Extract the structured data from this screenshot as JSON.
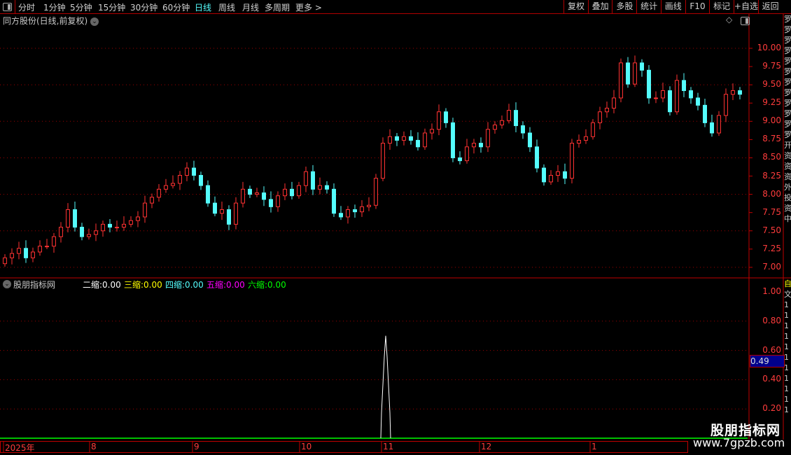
{
  "toolbar": {
    "periods": [
      "分时",
      "1分钟",
      "5分钟",
      "15分钟",
      "30分钟",
      "60分钟",
      "日线",
      "周线",
      "月线",
      "多周期",
      "更多 >"
    ],
    "active_period": "日线",
    "buttons": [
      "复权",
      "叠加",
      "多股",
      "统计",
      "画线",
      "F10",
      "标记",
      "+自选",
      "返回"
    ]
  },
  "main_chart": {
    "title": "同方股份(日线,前复权)",
    "price_ticks": [
      "10.00",
      "9.75",
      "9.50",
      "9.25",
      "9.00",
      "8.75",
      "8.50",
      "8.25",
      "8.00",
      "7.75",
      "7.50",
      "7.25",
      "7.00"
    ],
    "colors": {
      "up": "#ff3232",
      "down": "#54fcfc",
      "grid": "#a00000"
    }
  },
  "indicator": {
    "name": "股朋指标网",
    "values": [
      {
        "label": "二缩:",
        "value": "0.00",
        "color": "#ffffff"
      },
      {
        "label": "三缩:",
        "value": "0.00",
        "color": "#ffff00"
      },
      {
        "label": "四缩:",
        "value": "0.00",
        "color": "#54fcfc"
      },
      {
        "label": "五缩:",
        "value": "0.00",
        "color": "#ff00ff"
      },
      {
        "label": "六缩:",
        "value": "0.00",
        "color": "#00ff00"
      }
    ],
    "ticks": [
      "1.00",
      "0.80",
      "0.60",
      "0.40",
      "0.20"
    ],
    "cursor_value": "0.49",
    "spike_peak": 0.7
  },
  "date_axis": [
    "2025年",
    "8",
    "9",
    "10",
    "11",
    "12",
    "1"
  ],
  "watermark": {
    "name": "股朋指标网",
    "url": "www.7gpzb.com"
  },
  "chart_data": {
    "type": "candlestick",
    "ylim": [
      7.0,
      10.0
    ],
    "close": [
      7.13,
      7.19,
      7.26,
      7.13,
      7.21,
      7.29,
      7.29,
      7.42,
      7.55,
      7.79,
      7.55,
      7.42,
      7.45,
      7.5,
      7.59,
      7.55,
      7.55,
      7.59,
      7.64,
      7.69,
      7.88,
      7.96,
      8.07,
      8.12,
      8.15,
      8.26,
      8.36,
      8.26,
      8.12,
      7.88,
      7.74,
      7.79,
      7.59,
      7.88,
      8.07,
      8.0,
      8.02,
      7.93,
      7.83,
      7.98,
      8.07,
      7.98,
      8.12,
      8.31,
      8.07,
      8.12,
      8.07,
      7.74,
      7.69,
      7.79,
      7.76,
      7.83,
      7.85,
      8.22,
      8.7,
      8.79,
      8.74,
      8.79,
      8.74,
      8.65,
      8.84,
      8.89,
      9.13,
      8.98,
      8.5,
      8.46,
      8.65,
      8.7,
      8.65,
      8.89,
      8.95,
      9.01,
      9.15,
      8.94,
      8.84,
      8.65,
      8.36,
      8.17,
      8.26,
      8.31,
      8.22,
      8.7,
      8.74,
      8.79,
      8.98,
      9.13,
      9.18,
      9.32,
      9.8,
      9.51,
      9.8,
      9.7,
      9.32,
      9.32,
      9.42,
      9.13,
      9.56,
      9.42,
      9.32,
      9.22,
      8.98,
      8.84,
      9.08,
      9.37,
      9.42,
      9.37
    ],
    "first_open": 7.05,
    "indicator_spike_index": 55,
    "indicator_spike_value": 0.7
  }
}
